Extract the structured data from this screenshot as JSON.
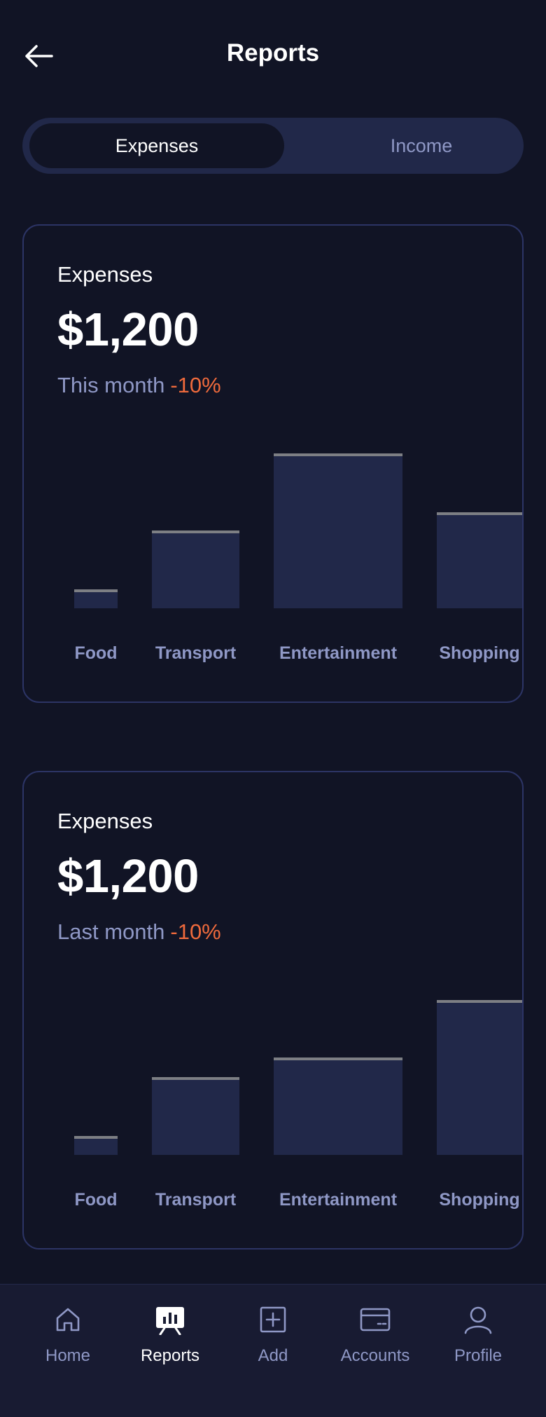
{
  "header": {
    "title": "Reports",
    "back_icon": "arrow-left-icon"
  },
  "segmented": {
    "tabs": [
      {
        "label": "Expenses",
        "active": true
      },
      {
        "label": "Income",
        "active": false
      }
    ]
  },
  "colors": {
    "background": "#111425",
    "surface": "#212849",
    "muted_text": "#8f98c6",
    "negative": "#ef6a3c",
    "bar_cap": "#7d7f84"
  },
  "cards": [
    {
      "label": "Expenses",
      "amount": "$1,200",
      "period": "This month",
      "change": "-10%"
    },
    {
      "label": "Expenses",
      "amount": "$1,200",
      "period": "Last month",
      "change": "-10%"
    }
  ],
  "chart_data": [
    {
      "type": "bar",
      "categories": [
        "Food",
        "Transport",
        "Entertainment",
        "Shopping"
      ],
      "values": [
        12,
        50,
        100,
        62
      ],
      "ylim": [
        0,
        100
      ],
      "grid": false
    },
    {
      "type": "bar",
      "categories": [
        "Food",
        "Transport",
        "Entertainment",
        "Shopping"
      ],
      "values": [
        12,
        50,
        63,
        100
      ],
      "ylim": [
        0,
        100
      ],
      "grid": false
    }
  ],
  "bottom_nav": [
    {
      "label": "Home",
      "icon": "home-icon",
      "active": false
    },
    {
      "label": "Reports",
      "icon": "reports-icon",
      "active": true
    },
    {
      "label": "Add",
      "icon": "add-icon",
      "active": false
    },
    {
      "label": "Accounts",
      "icon": "accounts-icon",
      "active": false
    },
    {
      "label": "Profile",
      "icon": "profile-icon",
      "active": false
    }
  ]
}
